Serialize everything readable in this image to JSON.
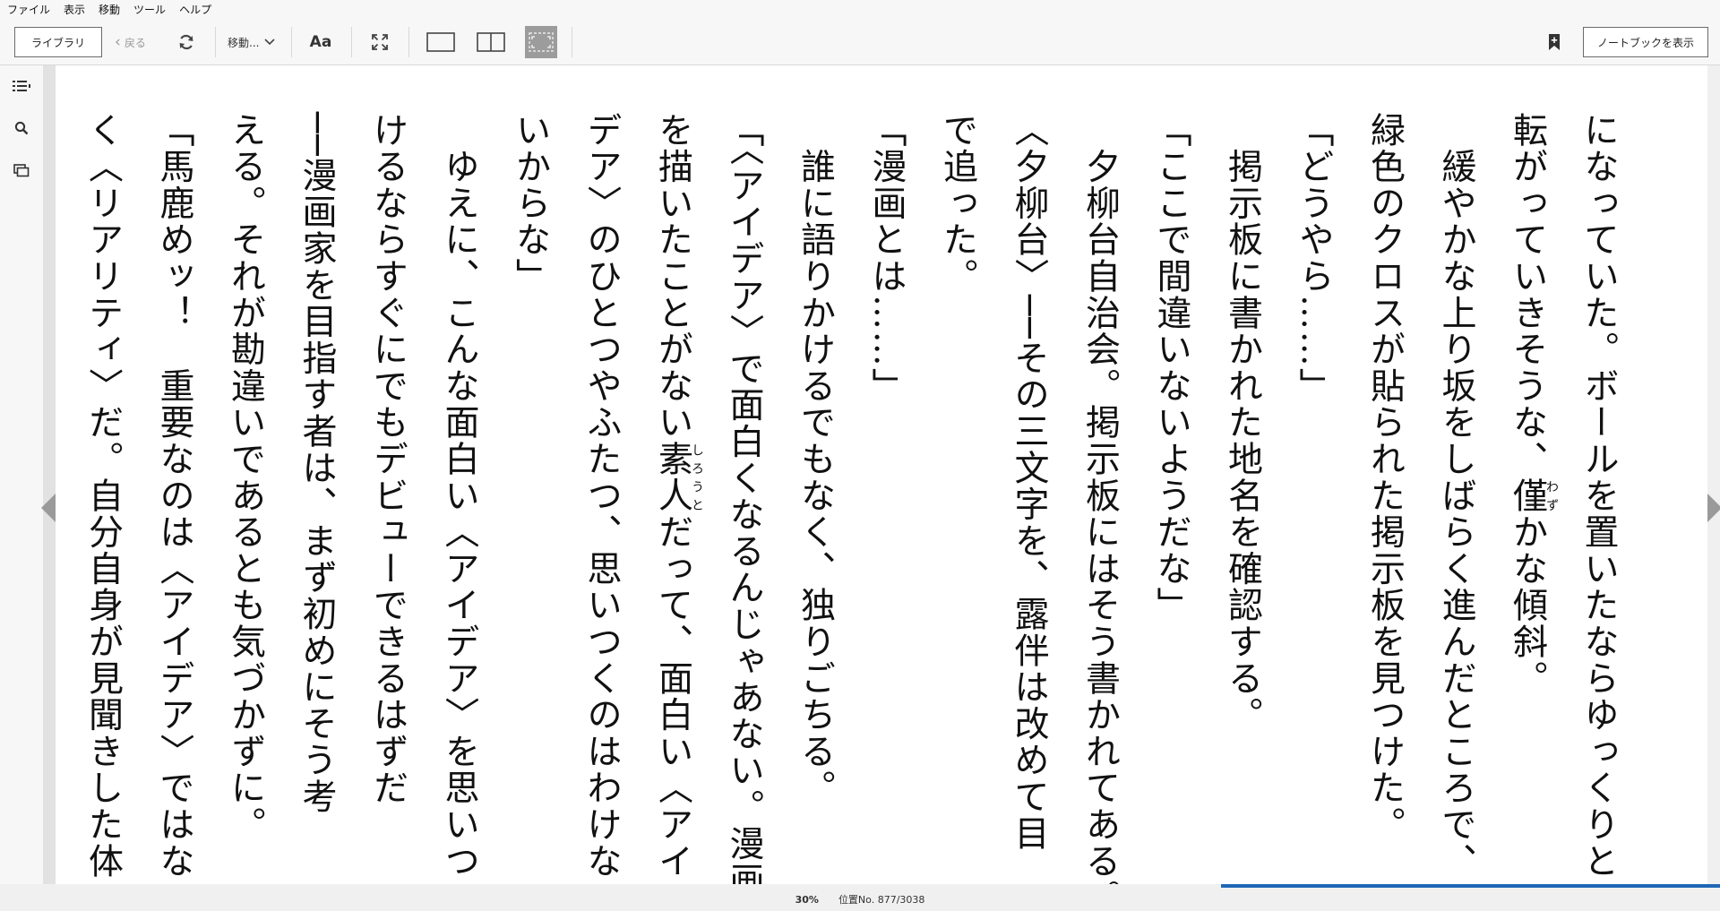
{
  "menu": [
    "ファイル",
    "表示",
    "移動",
    "ツール",
    "ヘルプ"
  ],
  "toolbar": {
    "library_label": "ライブラリ",
    "back_label": "戻る",
    "goto_label": "移動...",
    "font_label": "Aa",
    "notebook_label": "ノートブックを表示"
  },
  "icons": {
    "sync": "sync-icon",
    "fullscreen": "fullscreen-icon",
    "single_page": "single-page-icon",
    "two_page": "two-page-icon",
    "fit_page": "fit-page-icon",
    "bookmark": "bookmark-add-icon",
    "toc": "toc-icon",
    "search": "search-icon",
    "flashcards": "cards-icon"
  },
  "colors": {
    "progress": "#1f67b5",
    "fit_active": "#9c9c9c"
  },
  "text_lines": [
    "になっていた。ボールを置いたならゆっくりと",
    "転がっていきそうな、僅かな傾斜。",
    "　緩やかな上り坂をしばらく進んだところで、",
    "緑色のクロスが貼られた掲示板を見つけた。",
    "「どうやら……」",
    "　掲示板に書かれた地名を確認する。",
    "「ここで間違いないようだな」",
    "　夕柳台自治会。掲示板にはそう書かれてある。",
    "〈夕柳台〉──その三文字を、露伴は改めて目",
    "で追った。",
    "「漫画とは……」",
    "　誰に語りかけるでもなく、独りごちる。",
    "「〈アイデア〉で面白くなるんじゃあない。漫画",
    "を描いたことがない素人だって、面白い〈アイ",
    "デア〉のひとつやふたつ、思いつくのはわけな",
    "いからな」",
    "　ゆえに、こんな面白い〈アイデア〉を思いつ",
    "けるならすぐにでもデビューできるはずだ",
    "──漫画家を目指す者は、まず初めにそう考",
    "える。それが勘違いであるとも気づかずに。",
    "「馬鹿めッ！　重要なのは〈アイデア〉ではな",
    "く〈リアリティ〉だ。自分自身が見聞きした体"
  ],
  "ruby": [
    {
      "line": 1,
      "base": "僅",
      "reading": "わず"
    },
    {
      "line": 13,
      "base": "素人",
      "reading": "しろうと"
    }
  ],
  "status": {
    "percent": "30%",
    "location": "位置No. 877/3038",
    "progress_fraction": 0.29
  }
}
